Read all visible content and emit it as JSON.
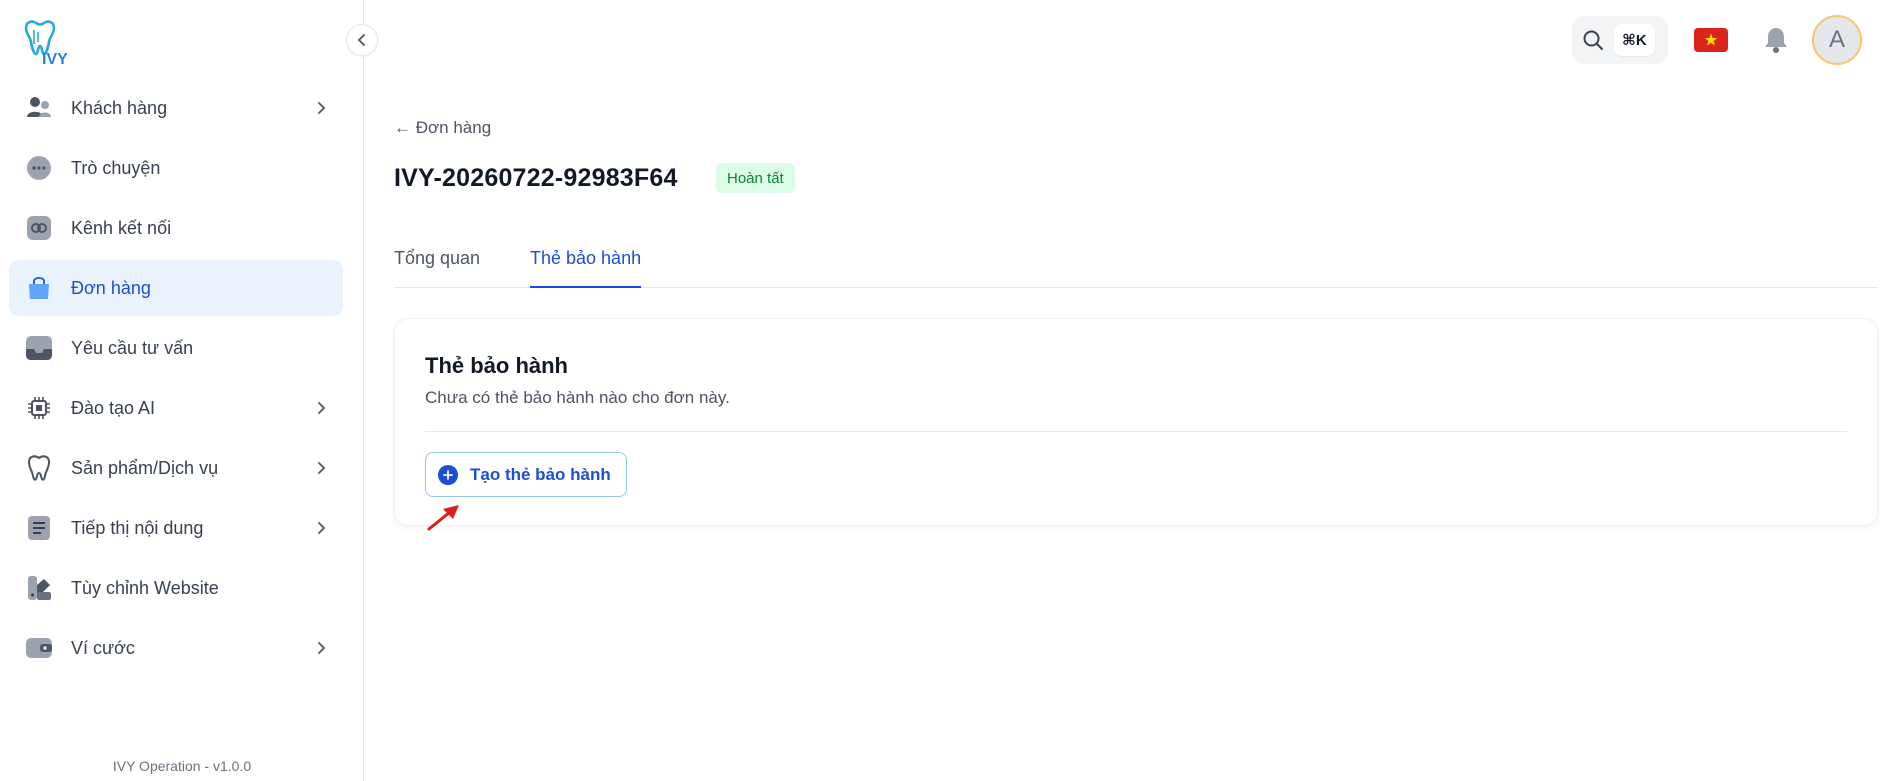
{
  "sidebar": {
    "logo_text": "IVY",
    "items": [
      {
        "label": "Khách hàng",
        "icon": "users-icon",
        "chevron": true,
        "active": false
      },
      {
        "label": "Trò chuyện",
        "icon": "chat-icon",
        "chevron": false,
        "active": false
      },
      {
        "label": "Kênh kết nối",
        "icon": "link-icon",
        "chevron": false,
        "active": false
      },
      {
        "label": "Đơn hàng",
        "icon": "shopping-bag-icon",
        "chevron": false,
        "active": true
      },
      {
        "label": "Yêu cầu tư vấn",
        "icon": "inbox-icon",
        "chevron": false,
        "active": false
      },
      {
        "label": "Đào tạo AI",
        "icon": "cpu-icon",
        "chevron": true,
        "active": false
      },
      {
        "label": "Sản phẩm/Dịch vụ",
        "icon": "tooth-icon",
        "chevron": true,
        "active": false
      },
      {
        "label": "Tiếp thị nội dung",
        "icon": "document-icon",
        "chevron": true,
        "active": false
      },
      {
        "label": "Tùy chỉnh Website",
        "icon": "palette-icon",
        "chevron": false,
        "active": false
      },
      {
        "label": "Ví cước",
        "icon": "wallet-icon",
        "chevron": true,
        "active": false
      }
    ],
    "version": "IVY Operation - v1.0.0"
  },
  "topbar": {
    "shortcut": "⌘K",
    "avatar_initial": "A"
  },
  "main": {
    "back_link": "← Đơn hàng",
    "order_id": "IVY-20260722-92983F64",
    "status": "Hoàn tất",
    "tabs": [
      {
        "label": "Tổng quan",
        "active": false
      },
      {
        "label": "Thẻ bảo hành",
        "active": true
      }
    ],
    "card": {
      "title": "Thẻ bảo hành",
      "subtitle": "Chưa có thẻ bảo hành nào cho đơn này.",
      "create_button": "Tạo thẻ bảo hành"
    }
  },
  "colors": {
    "accent": "#1d4ed8",
    "active_bg": "#eaf2fe",
    "status_bg": "#dcfce7",
    "status_text": "#15803d",
    "annotation": "#e11d1d"
  }
}
